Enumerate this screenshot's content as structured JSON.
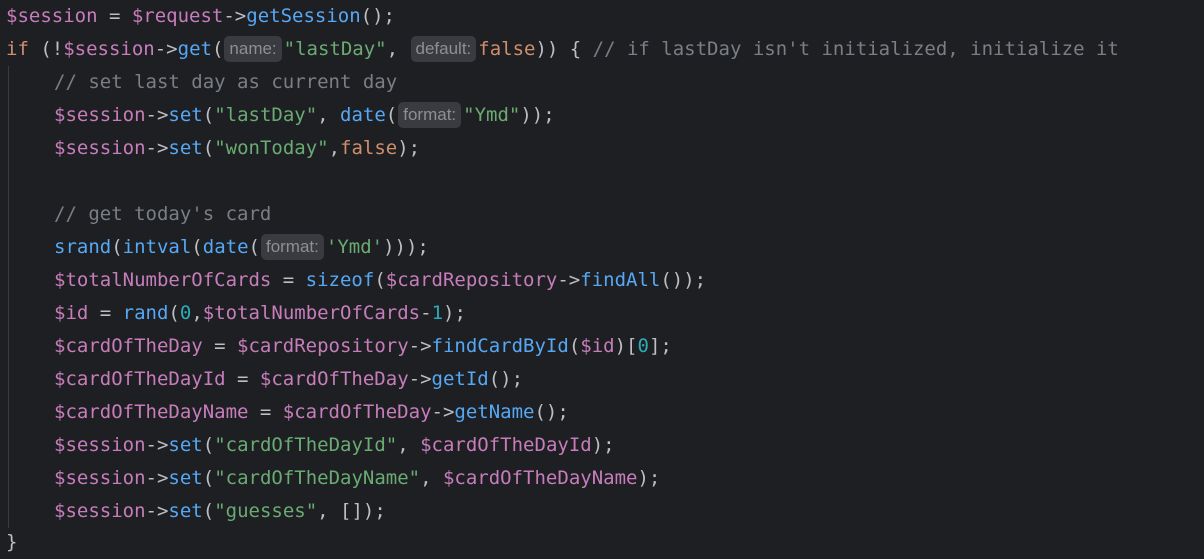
{
  "l1": {
    "a": "$session",
    "b": " = ",
    "c": "$request",
    "d": "->",
    "e": "getSession",
    "f": "();"
  },
  "l2": {
    "a": "if",
    "b": " (!",
    "c": "$session",
    "d": "->",
    "e": "get",
    "f": "(",
    "h1": "name:",
    "g": "\"lastDay\"",
    "i": ", ",
    "h2": "default:",
    "j": "false",
    "k": ")) { ",
    "cmt": "// if lastDay isn't initialized, initialize it"
  },
  "l3": {
    "cmt": "// set last day as current day"
  },
  "l4": {
    "a": "$session",
    "b": "->",
    "c": "set",
    "d": "(",
    "e": "\"lastDay\"",
    "f": ", ",
    "g": "date",
    "h": "(",
    "hint": "format:",
    "i": "\"Ymd\"",
    "j": "));"
  },
  "l5": {
    "a": "$session",
    "b": "->",
    "c": "set",
    "d": "(",
    "e": "\"wonToday\"",
    "f": ",",
    "g": "false",
    "h": ");"
  },
  "l7": {
    "cmt": "// get today's card"
  },
  "l8": {
    "a": "srand",
    "b": "(",
    "c": "intval",
    "d": "(",
    "e": "date",
    "f": "(",
    "hint": "format:",
    "g": "'Ymd'",
    "h": ")));"
  },
  "l9": {
    "a": "$totalNumberOfCards",
    "b": " = ",
    "c": "sizeof",
    "d": "(",
    "e": "$cardRepository",
    "f": "->",
    "g": "findAll",
    "h": "());"
  },
  "l10": {
    "a": "$id",
    "b": " = ",
    "c": "rand",
    "d": "(",
    "e": "0",
    "f": ",",
    "g": "$totalNumberOfCards",
    "h": "-",
    "i": "1",
    "j": ");"
  },
  "l11": {
    "a": "$cardOfTheDay",
    "b": " = ",
    "c": "$cardRepository",
    "d": "->",
    "e": "findCardById",
    "f": "(",
    "g": "$id",
    "h": ")[",
    "i": "0",
    "j": "];"
  },
  "l12": {
    "a": "$cardOfTheDayId",
    "b": " = ",
    "c": "$cardOfTheDay",
    "d": "->",
    "e": "getId",
    "f": "();"
  },
  "l13": {
    "a": "$cardOfTheDayName",
    "b": " = ",
    "c": "$cardOfTheDay",
    "d": "->",
    "e": "getName",
    "f": "();"
  },
  "l14": {
    "a": "$session",
    "b": "->",
    "c": "set",
    "d": "(",
    "e": "\"cardOfTheDayId\"",
    "f": ", ",
    "g": "$cardOfTheDayId",
    "h": ");"
  },
  "l15": {
    "a": "$session",
    "b": "->",
    "c": "set",
    "d": "(",
    "e": "\"cardOfTheDayName\"",
    "f": ", ",
    "g": "$cardOfTheDayName",
    "h": ");"
  },
  "l16": {
    "a": "$session",
    "b": "->",
    "c": "set",
    "d": "(",
    "e": "\"guesses\"",
    "f": ", [",
    "g": "]);"
  },
  "l17": {
    "a": "}"
  },
  "colors": {
    "background": "#1e1f22",
    "variable": "#c77dbb",
    "function": "#56a8f5",
    "string": "#6aab73",
    "keyword": "#cf8e6d",
    "number": "#2aacb8",
    "comment": "#7a7e85",
    "plain": "#bcbec4",
    "inlay_hint_bg": "#393b40"
  }
}
